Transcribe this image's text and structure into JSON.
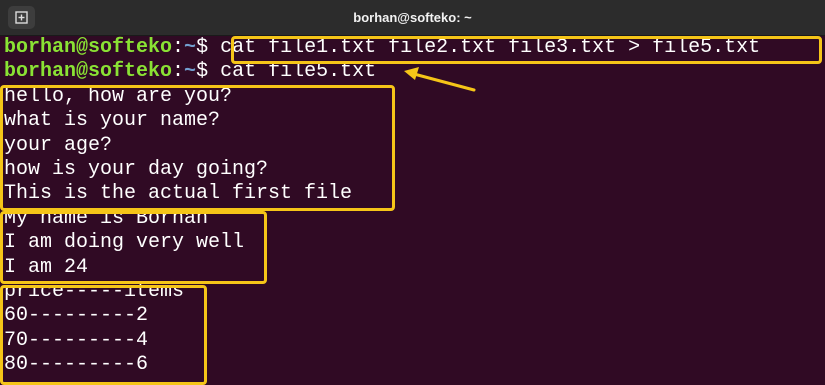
{
  "window": {
    "title": "borhan@softeko: ~"
  },
  "prompt": {
    "user_host": "borhan@softeko",
    "separator": ":",
    "path": "~",
    "symbol": "$ "
  },
  "commands": [
    "cat file1.txt file2.txt file3.txt > file5.txt",
    "cat file5.txt"
  ],
  "output_groups": [
    {
      "lines": [
        "hello, how are you?",
        "what is your name?",
        "your age?",
        "how is your day going?",
        "This is the actual first file"
      ]
    },
    {
      "lines": [
        "My name is Borhan",
        "I am doing very well",
        "I am 24"
      ]
    },
    {
      "lines": [
        "price-----items",
        "60---------2",
        "70---------4",
        "80---------6"
      ]
    }
  ],
  "colors": {
    "background": "#300a24",
    "titlebar": "#2c2c2c",
    "prompt_user": "#8ae234",
    "prompt_path": "#729fcf",
    "text": "#ffffff",
    "highlight": "#f5c518"
  },
  "icons": {
    "new_tab": "new-tab-icon",
    "annotation_arrow": "arrow-left-icon"
  }
}
